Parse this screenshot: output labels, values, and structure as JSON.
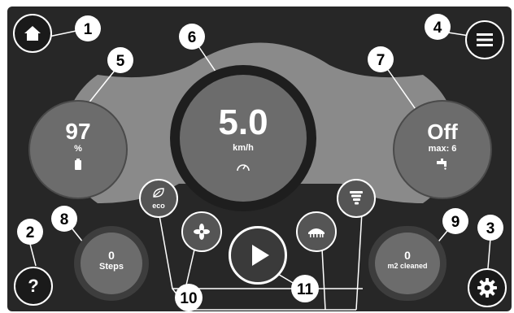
{
  "colors": {
    "background": "#272727",
    "panel": "#8a8a8a",
    "gauge": "#6c6c6c",
    "button_ring": "#ffffff",
    "callout": "#ffffff",
    "callout_text": "#000000"
  },
  "battery": {
    "value": "97",
    "unit": "%",
    "icon": "battery-icon"
  },
  "speed": {
    "value": "5.0",
    "unit": "km/h",
    "icon": "speedometer-icon"
  },
  "water": {
    "value": "Off",
    "max_label": "max: 6",
    "icon": "faucet-icon"
  },
  "steps": {
    "value": "0",
    "label": "Steps"
  },
  "area": {
    "value": "0",
    "label": "m2 cleaned"
  },
  "buttons": {
    "eco_label": "eco",
    "home_icon": "home-icon",
    "menu_icon": "menu-icon",
    "help_label": "?",
    "settings_icon": "gear-icon",
    "fan_icon": "fan-icon",
    "brush_icon": "brush-icon",
    "tornado_icon": "tornado-icon",
    "play_icon": "play-icon"
  },
  "callouts": [
    "1",
    "2",
    "3",
    "4",
    "5",
    "6",
    "7",
    "8",
    "9",
    "10",
    "11"
  ]
}
